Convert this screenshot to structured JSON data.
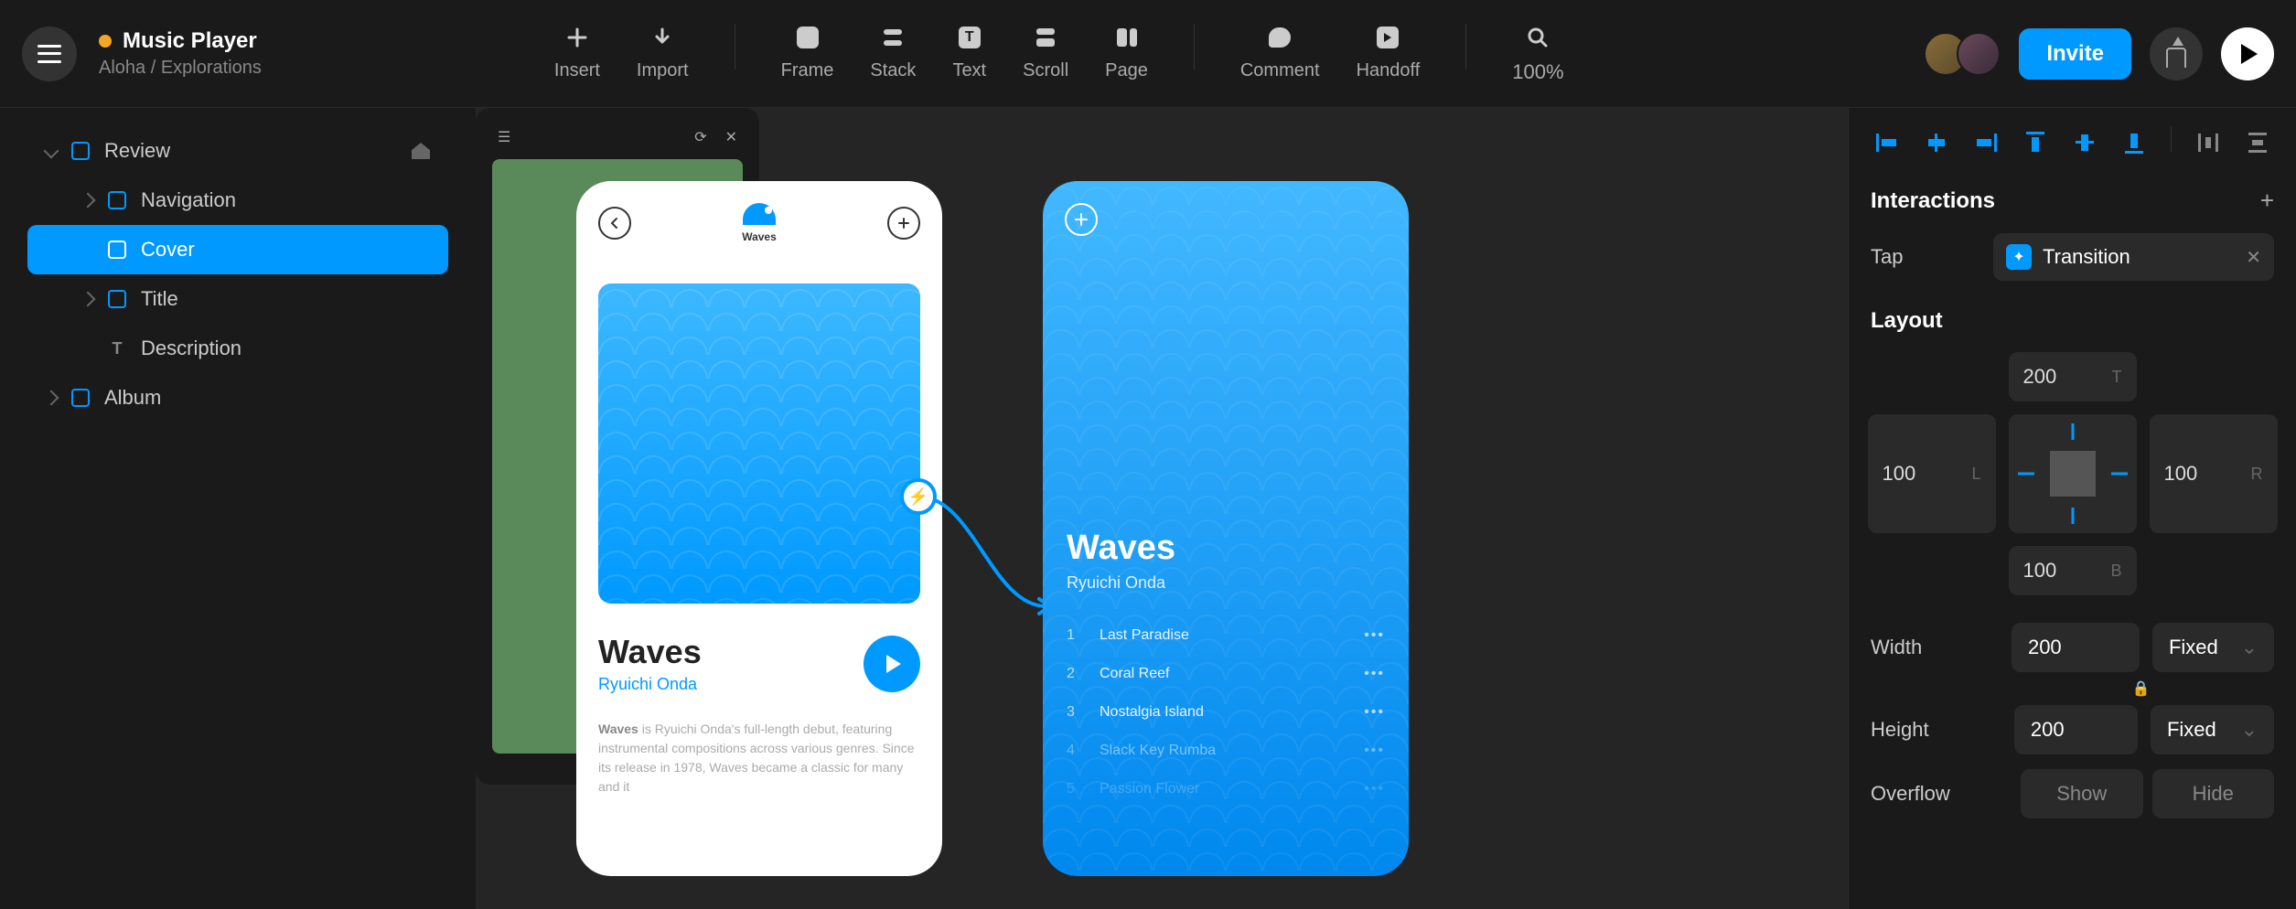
{
  "project": {
    "title": "Music Player",
    "path": "Aloha / Explorations"
  },
  "toolbar": {
    "insert": "Insert",
    "import": "Import",
    "frame": "Frame",
    "stack": "Stack",
    "text": "Text",
    "scroll": "Scroll",
    "page": "Page",
    "comment": "Comment",
    "handoff": "Handoff"
  },
  "zoom": "100%",
  "invite": "Invite",
  "sidebar": {
    "items": [
      {
        "label": "Review"
      },
      {
        "label": "Navigation"
      },
      {
        "label": "Cover"
      },
      {
        "label": "Title"
      },
      {
        "label": "Description"
      },
      {
        "label": "Album"
      }
    ]
  },
  "artboard1": {
    "logo_text": "Waves",
    "title": "Waves",
    "artist": "Ryuichi Onda",
    "desc_bold": "Waves",
    "desc": " is Ryuichi Onda's full-length debut, featuring instrumental compositions across various genres. Since its release in 1978, Waves became a classic for many and it"
  },
  "artboard2": {
    "title": "Waves",
    "artist": "Ryuichi Onda",
    "tracks": [
      {
        "n": "1",
        "name": "Last Paradise"
      },
      {
        "n": "2",
        "name": "Coral Reef"
      },
      {
        "n": "3",
        "name": "Nostalgia Island"
      },
      {
        "n": "4",
        "name": "Slack Key Rumba"
      },
      {
        "n": "5",
        "name": "Passion Flower"
      }
    ]
  },
  "panel": {
    "interactions_title": "Interactions",
    "tap_label": "Tap",
    "transition": "Transition",
    "layout_title": "Layout",
    "pos": {
      "t": "200",
      "l": "100",
      "r": "100",
      "b": "100"
    },
    "width_label": "Width",
    "width": "200",
    "width_mode": "Fixed",
    "height_label": "Height",
    "height": "200",
    "height_mode": "Fixed",
    "overflow_label": "Overflow",
    "show": "Show",
    "hide": "Hide"
  }
}
